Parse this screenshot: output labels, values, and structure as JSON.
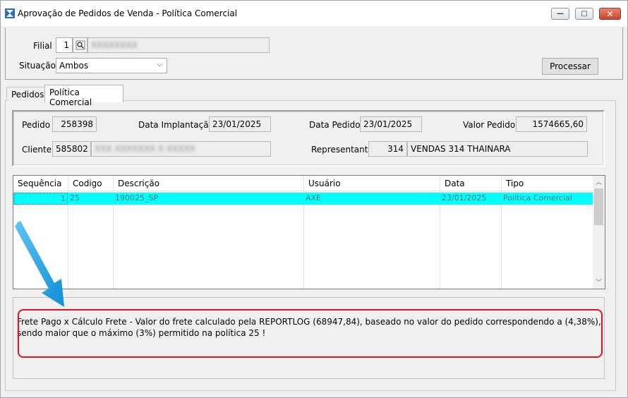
{
  "window": {
    "title": "Aprovação de Pedidos de Venda - Política Comercial",
    "minimize_icon": "minimize-icon",
    "maximize_icon": "maximize-icon",
    "close_icon": "close-icon"
  },
  "filters": {
    "filial_label": "Filial",
    "filial_value": "1",
    "filial_name": "XXXXXXXX",
    "situacao_label": "Situação",
    "situacao_value": "Ambos",
    "processar_label": "Processar"
  },
  "tabs": [
    {
      "label": "Pedidos",
      "active": false
    },
    {
      "label": "Política Comercial",
      "active": true
    }
  ],
  "order": {
    "pedido_label": "Pedido",
    "pedido_value": "258398",
    "data_implantacao_label": "Data Implantação",
    "data_implantacao_value": "23/01/2025",
    "data_pedido_label": "Data Pedido",
    "data_pedido_value": "23/01/2025",
    "valor_pedido_label": "Valor Pedido",
    "valor_pedido_value": "1574665,60",
    "cliente_label": "Cliente",
    "cliente_value": "585802",
    "cliente_name": "XXX XXXXXXX X XXXXX",
    "representante_label": "Representante",
    "representante_code": "314",
    "representante_name": "VENDAS 314 THAINARA"
  },
  "grid": {
    "columns": [
      "Sequência",
      "Codigo",
      "Descrição",
      "Usuário",
      "Data",
      "Tipo"
    ],
    "rows": [
      {
        "sequencia": "1",
        "codigo": "25",
        "descricao": "190025_SP",
        "usuario": "AXE",
        "data": "23/01/2025",
        "tipo": "Política Comercial"
      }
    ]
  },
  "message": "Frete Pago x Cálculo Frete - Valor do frete calculado pela REPORTLOG (68947,84), baseado no valor do pedido correspondendo a (4,38%), sendo maior que o máximo (3%) permitido na política 25 !",
  "colors": {
    "selected_row": "#00ffff",
    "highlight_box": "#e0151b",
    "arrow": "#1fa3e6"
  }
}
